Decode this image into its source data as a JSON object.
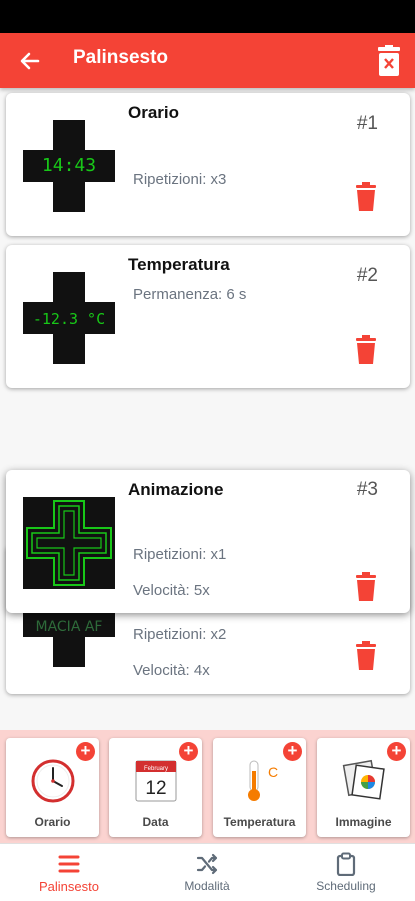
{
  "app_bar": {
    "title": "Palinsesto"
  },
  "cards": [
    {
      "title": "Orario",
      "number": "#1",
      "display": "14:43",
      "lines": [
        "Ripetizioni: x3"
      ]
    },
    {
      "title": "Temperatura",
      "number": "#2",
      "display": "-12.3 °C",
      "lines": [
        "Permanenza: 6 s"
      ]
    },
    {
      "title": "",
      "number": "",
      "display": "MACIA AF",
      "lines": [
        "Ripetizioni: x2",
        "Velocità: 4x"
      ]
    },
    {
      "title": "Animazione",
      "number": "#3",
      "display": "",
      "lines": [
        "Ripetizioni: x1",
        "Velocità: 5x"
      ]
    }
  ],
  "add_tiles": [
    {
      "label": "Orario",
      "icon": "clock-icon"
    },
    {
      "label": "Data",
      "icon": "calendar-icon",
      "calendar_month": "February",
      "calendar_day": "12"
    },
    {
      "label": "Temperatura",
      "icon": "thermometer-icon",
      "unit": "C"
    },
    {
      "label": "Immagine",
      "icon": "image-icon"
    }
  ],
  "bottom_nav": [
    {
      "label": "Palinsesto",
      "icon": "menu-icon",
      "active": true
    },
    {
      "label": "Modalità",
      "icon": "shuffle-icon",
      "active": false
    },
    {
      "label": "Scheduling",
      "icon": "clipboard-icon",
      "active": false
    }
  ],
  "colors": {
    "primary": "#f44336",
    "led_green": "#18c718",
    "tile_bg": "#fbd3d0"
  }
}
